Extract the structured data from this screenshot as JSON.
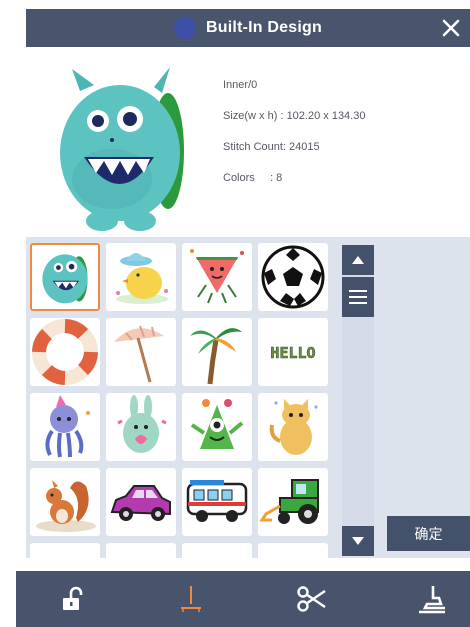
{
  "dialog": {
    "title": "Built-In Design",
    "title_icon": "sewing-logo-icon",
    "close_icon": "close-icon"
  },
  "design_info": {
    "name": "Inner/0",
    "size": "Size(w x h) :  102.20 x 134.30",
    "stitch_count": "Stitch Count: 24015",
    "colors": "Colors     : 8"
  },
  "designs": [
    {
      "name": "monster",
      "icon": "monster-icon",
      "selected": true
    },
    {
      "name": "chick",
      "icon": "chick-icon"
    },
    {
      "name": "watermelon",
      "icon": "watermelon-icon"
    },
    {
      "name": "soccer-ball",
      "icon": "soccer-ball-icon"
    },
    {
      "name": "life-ring",
      "icon": "life-ring-icon"
    },
    {
      "name": "beach-umbrella",
      "icon": "beach-umbrella-icon"
    },
    {
      "name": "palm-tree",
      "icon": "palm-tree-icon"
    },
    {
      "name": "hello-text",
      "icon": "hello-text-icon",
      "text": "HELLO"
    },
    {
      "name": "octopus",
      "icon": "octopus-icon"
    },
    {
      "name": "rabbit",
      "icon": "rabbit-icon"
    },
    {
      "name": "green-monster",
      "icon": "green-monster-icon"
    },
    {
      "name": "cat",
      "icon": "cat-icon"
    },
    {
      "name": "squirrel",
      "icon": "squirrel-icon"
    },
    {
      "name": "car",
      "icon": "car-icon"
    },
    {
      "name": "bus",
      "icon": "bus-icon"
    },
    {
      "name": "tractor",
      "icon": "tractor-icon"
    }
  ],
  "scroll": {
    "up_icon": "arrow-up-icon",
    "menu_icon": "menu-icon",
    "down_icon": "arrow-down-icon"
  },
  "confirm_label": "确定",
  "bottom_toolbar": [
    {
      "name": "unlock",
      "icon": "unlock-icon"
    },
    {
      "name": "needle",
      "icon": "needle-icon"
    },
    {
      "name": "thread-cut",
      "icon": "scissors-icon"
    },
    {
      "name": "presser-foot",
      "icon": "presser-foot-icon"
    }
  ],
  "colors": {
    "title_bar": "#49556d",
    "accent_selected": "#f18a3e",
    "panel": "#dde3ec",
    "bottom_bar": "#47546c"
  }
}
